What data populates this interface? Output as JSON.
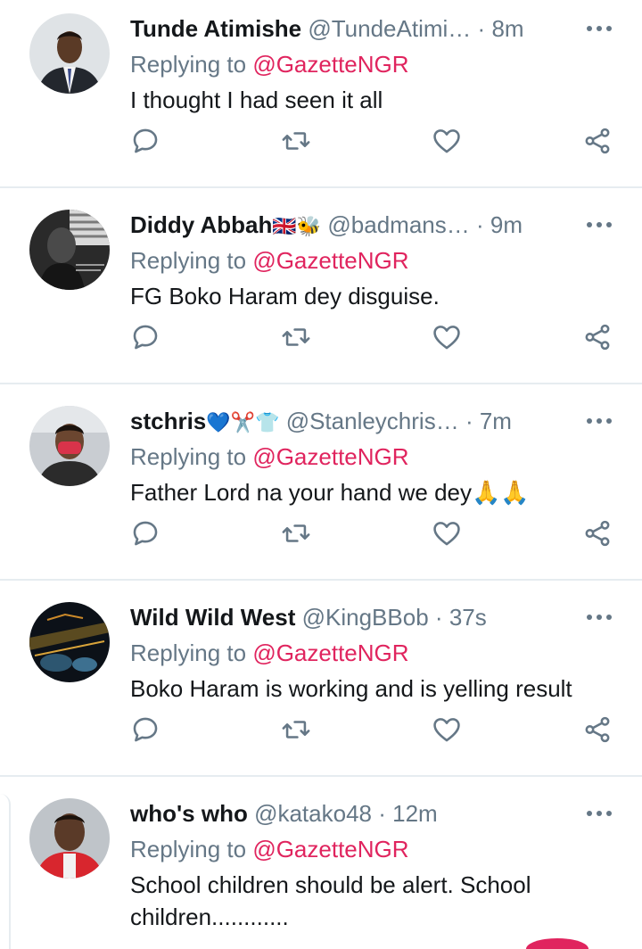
{
  "tweets": [
    {
      "name": "Tunde Atimishe",
      "name_emoji": "",
      "handle": "@TundeAtimi…",
      "time": "8m",
      "replying_prefix": "Replying to",
      "mention": "@GazetteNGR",
      "text": "I thought I had seen it all"
    },
    {
      "name": "Diddy Abbah",
      "name_emoji": "🇬🇧🐝",
      "handle": "@badmans…",
      "time": "9m",
      "replying_prefix": "Replying to",
      "mention": "@GazetteNGR",
      "text": "FG Boko Haram dey disguise."
    },
    {
      "name": "stchris",
      "name_emoji": "💙✂️👕",
      "handle": "@Stanleychris…",
      "time": "7m",
      "replying_prefix": "Replying to",
      "mention": "@GazetteNGR",
      "text": "Father Lord na your hand we dey🙏🙏"
    },
    {
      "name": "Wild Wild West",
      "name_emoji": "",
      "handle": "@KingBBob",
      "time": "37s",
      "replying_prefix": "Replying to",
      "mention": "@GazetteNGR",
      "text": "Boko Haram is working and is yelling  result"
    },
    {
      "name": "who's who",
      "name_emoji": "",
      "handle": "@katako48",
      "time": "12m",
      "replying_prefix": "Replying to",
      "mention": "@GazetteNGR",
      "text": "School children should be alert. School children............"
    }
  ],
  "separator": "·",
  "icons": {
    "more": "more-dots-icon",
    "reply": "reply-bubble-icon",
    "retweet": "retweet-icon",
    "like": "heart-icon",
    "share": "share-icon"
  },
  "colors": {
    "text": "#14171a",
    "secondary": "#657786",
    "mention": "#e0245e",
    "divider": "#e6ecf0"
  }
}
